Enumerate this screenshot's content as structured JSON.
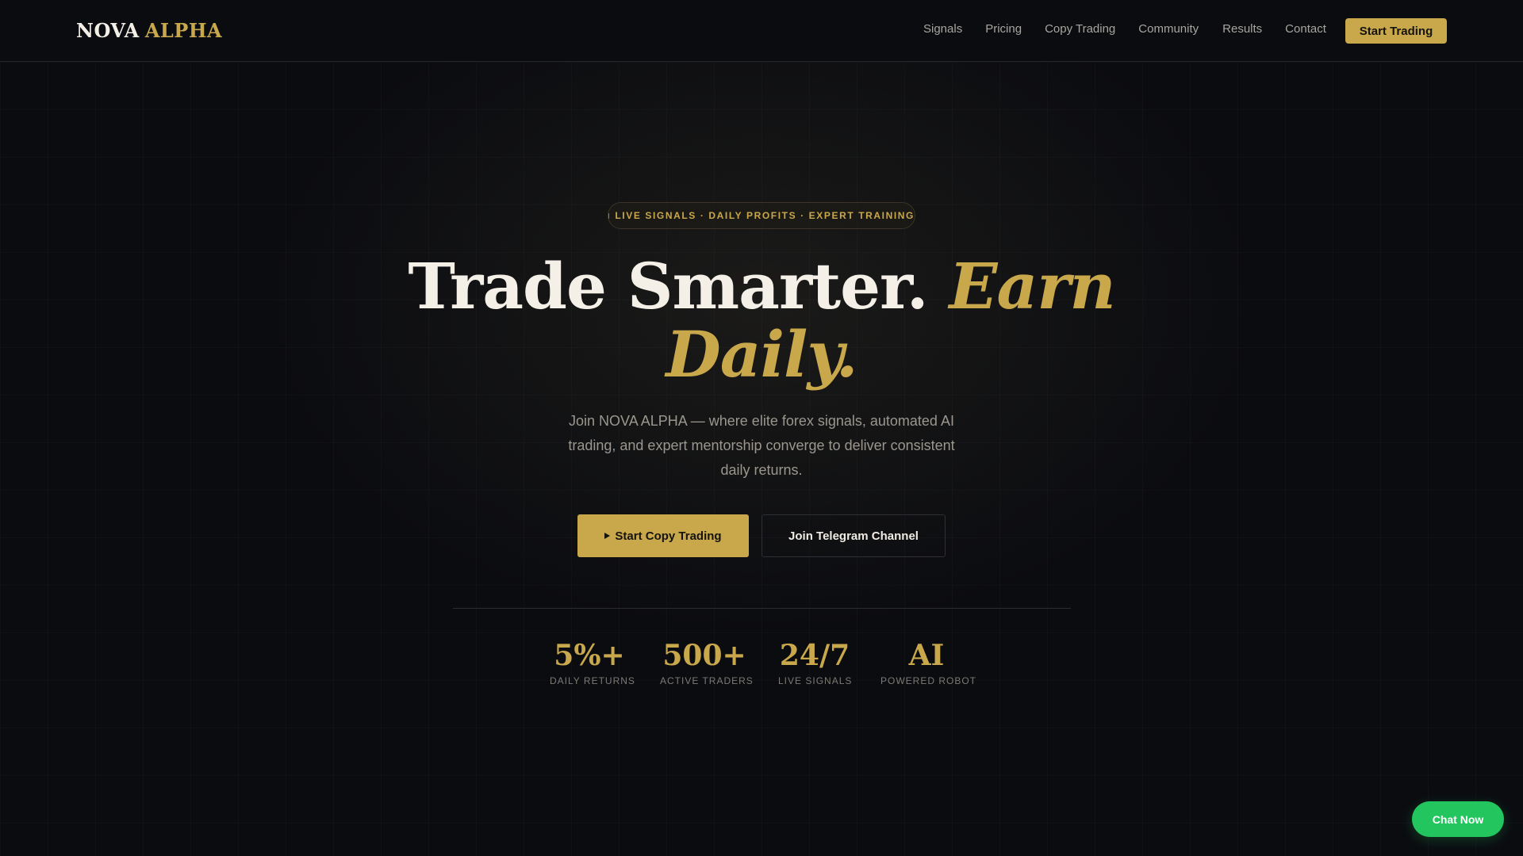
{
  "colors": {
    "accent": "#c9a84c",
    "background": "#0b0c10",
    "live_dot": "#2fb35a",
    "chat": "#22c55e"
  },
  "brand": {
    "part1": "NOVA",
    "part2": "ALPHA"
  },
  "nav": {
    "links": [
      "Signals",
      "Pricing",
      "Copy Trading",
      "Community",
      "Results",
      "Contact"
    ],
    "cta_label": "Start Trading"
  },
  "hero": {
    "badge": "LIVE SIGNALS · DAILY PROFITS · EXPERT TRAINING",
    "title_part1": "Trade Smarter.",
    "title_part2": "Earn Daily.",
    "subtitle": "Join NOVA ALPHA — where elite forex signals, automated AI trading, and expert mentorship converge to deliver consistent daily returns.",
    "primary_button": "Start Copy Trading",
    "primary_button_icon": "play-icon",
    "secondary_button": "Join Telegram Channel"
  },
  "stats": [
    {
      "value": "5%+",
      "label": "DAILY RETURNS"
    },
    {
      "value": "500+",
      "label": "ACTIVE TRADERS"
    },
    {
      "value": "24/7",
      "label": "LIVE SIGNALS"
    },
    {
      "value": "AI",
      "label": "POWERED ROBOT"
    }
  ],
  "chat": {
    "label": "Chat Now"
  }
}
